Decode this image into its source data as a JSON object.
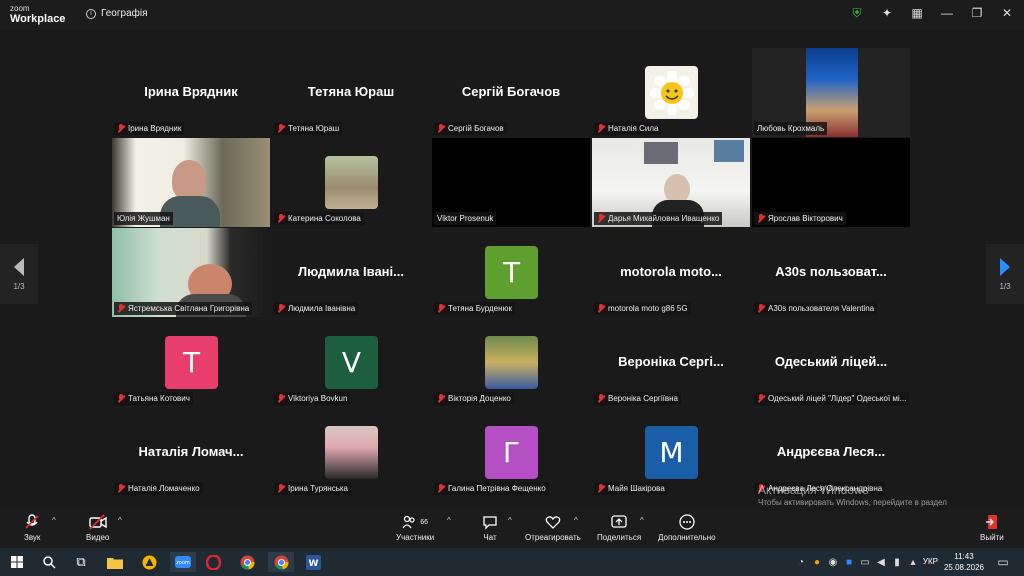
{
  "app": {
    "logo_line1": "zoom",
    "logo_line2": "Workplace",
    "meeting_title": "Географія",
    "info_icon": "info-icon"
  },
  "colors": {
    "green_border": "#3ddc84",
    "mic_red": "#e03131",
    "accent": "#2d8cff"
  },
  "pager": {
    "left": "1/3",
    "right": "1/3"
  },
  "participants": [
    {
      "name": "Ірина Врядник",
      "center": "Ірина Врядник"
    },
    {
      "name": "Тетяна Юраш",
      "center": "Тетяна Юраш"
    },
    {
      "name": "Сергій Богачов",
      "center": "Сергій Богачов"
    },
    {
      "name": "Наталія Сила",
      "center": ""
    },
    {
      "name": "Любовь Крохмаль",
      "center": ""
    },
    {
      "name": "Юлія Жушман",
      "center": ""
    },
    {
      "name": "Катерина Соколова",
      "center": ""
    },
    {
      "name": "Viktor Prosenuk",
      "center": ""
    },
    {
      "name": "Дарья Михайловна Иващенко",
      "center": ""
    },
    {
      "name": "Ярослав Вікторович",
      "center": ""
    },
    {
      "name": "Ястремська Світлана Григорівна",
      "center": ""
    },
    {
      "name": "Людмила Іванівна",
      "center": "Людмила Івані..."
    },
    {
      "name": "Тетяна Бурденюк",
      "center": "",
      "letter": "T"
    },
    {
      "name": "motorola moto g86 5G",
      "center": "motorola moto..."
    },
    {
      "name": "A30s пользователя Valentina",
      "center": "A30s пользоват..."
    },
    {
      "name": "Татьяна Котович",
      "center": "",
      "letter": "T"
    },
    {
      "name": "Viktoriya Bovkun",
      "center": "",
      "letter": "V"
    },
    {
      "name": "Вікторія Доценко",
      "center": ""
    },
    {
      "name": "Вероніка Сергіївна",
      "center": "Вероніка Сергі..."
    },
    {
      "name": "Одеський ліцей \"Лідер\" Одеської мі...",
      "center": "Одеський ліцей..."
    },
    {
      "name": "Наталія Ломаченко",
      "center": "Наталія Ломач..."
    },
    {
      "name": "Ірина Турянська",
      "center": ""
    },
    {
      "name": "Галина Петрівна Фещенко",
      "center": "",
      "letter": "Г"
    },
    {
      "name": "Майя Шакірова",
      "center": "",
      "letter": "M"
    },
    {
      "name": "Андреєва Леся Олександрівна",
      "center": "Андрєєва Леся..."
    }
  ],
  "toolbar": {
    "audio": "Звук",
    "video": "Видео",
    "participants": "Участники",
    "participants_count": "66",
    "chat": "Чат",
    "react": "Отреагировать",
    "share": "Поделиться",
    "more": "Дополнительно",
    "leave": "Выйти"
  },
  "watermark": {
    "title": "Активация Windows",
    "text": "Чтобы активировать Windows, перейдите в раздел \"Параметры\"."
  },
  "taskbar": {
    "lang": "УКР",
    "time": "11:43",
    "date": "25.08.2026"
  }
}
